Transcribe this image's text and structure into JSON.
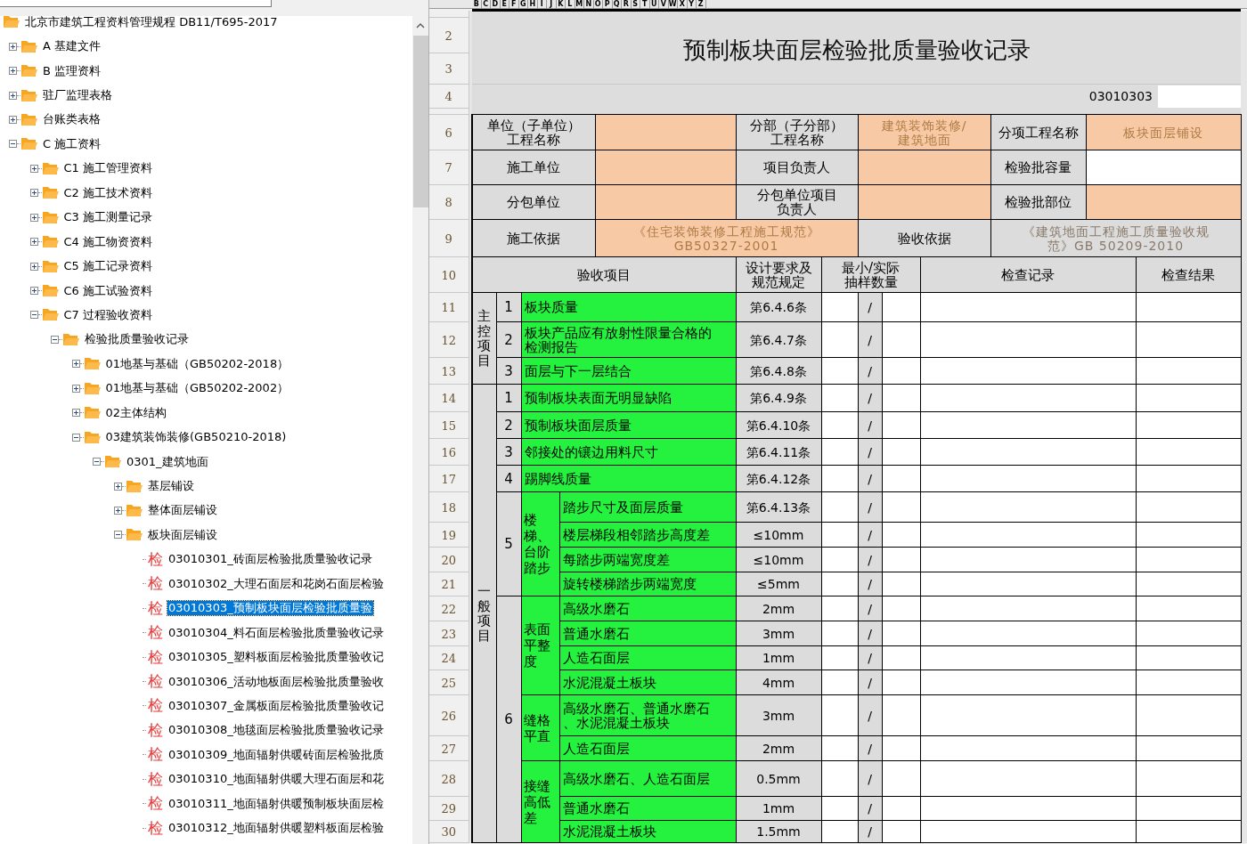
{
  "tree": {
    "label": "北京市建筑工程资料管理规程 DB11/T695-2017",
    "kind": "folder",
    "selected": false,
    "children": [
      {
        "label": "A 基建文件",
        "kind": "folder",
        "expanded": false,
        "selected": false
      },
      {
        "label": "B 监理资料",
        "kind": "folder",
        "expanded": false,
        "selected": false
      },
      {
        "label": "驻厂监理表格",
        "kind": "folder",
        "expanded": false,
        "selected": false
      },
      {
        "label": "台账类表格",
        "kind": "folder",
        "expanded": false,
        "selected": false
      },
      {
        "label": "C 施工资料",
        "kind": "folder",
        "expanded": true,
        "selected": false,
        "children": [
          {
            "label": "C1 施工管理资料",
            "kind": "folder",
            "expanded": false,
            "selected": false
          },
          {
            "label": "C2 施工技术资料",
            "kind": "folder",
            "expanded": false,
            "selected": false
          },
          {
            "label": "C3 施工测量记录",
            "kind": "folder",
            "expanded": false,
            "selected": false
          },
          {
            "label": "C4 施工物资资料",
            "kind": "folder",
            "expanded": false,
            "selected": false
          },
          {
            "label": "C5 施工记录资料",
            "kind": "folder",
            "expanded": false,
            "selected": false
          },
          {
            "label": "C6 施工试验资料",
            "kind": "folder",
            "expanded": false,
            "selected": false
          },
          {
            "label": "C7 过程验收资料",
            "kind": "folder",
            "expanded": true,
            "selected": false,
            "children": [
              {
                "label": "检验批质量验收记录",
                "kind": "folder",
                "expanded": true,
                "selected": false,
                "children": [
                  {
                    "label": "01地基与基础（GB50202-2018）",
                    "kind": "folder",
                    "expanded": false,
                    "selected": false
                  },
                  {
                    "label": "01地基与基础（GB50202-2002）",
                    "kind": "folder",
                    "expanded": false,
                    "selected": false
                  },
                  {
                    "label": "02主体结构",
                    "kind": "folder",
                    "expanded": false,
                    "selected": false
                  },
                  {
                    "label": "03建筑装饰装修(GB50210-2018)",
                    "kind": "folder",
                    "expanded": true,
                    "selected": false,
                    "children": [
                      {
                        "label": "0301_建筑地面",
                        "kind": "folder",
                        "expanded": true,
                        "selected": false,
                        "children": [
                          {
                            "label": "基层铺设",
                            "kind": "folder",
                            "expanded": false,
                            "selected": false
                          },
                          {
                            "label": "整体面层铺设",
                            "kind": "folder",
                            "expanded": false,
                            "selected": false
                          },
                          {
                            "label": "板块面层铺设",
                            "kind": "folder",
                            "expanded": true,
                            "selected": false,
                            "children": [
                              {
                                "label": "03010301_砖面层检验批质量验收记录",
                                "kind": "form",
                                "badge": "检",
                                "selected": false
                              },
                              {
                                "label": "03010302_大理石面层和花岗石面层检验",
                                "kind": "form",
                                "badge": "检",
                                "selected": false
                              },
                              {
                                "label": "03010303_预制板块面层检验批质量验",
                                "kind": "form",
                                "badge": "检",
                                "selected": true
                              },
                              {
                                "label": "03010304_料石面层检验批质量验收记录",
                                "kind": "form",
                                "badge": "检",
                                "selected": false
                              },
                              {
                                "label": "03010305_塑料板面层检验批质量验收记",
                                "kind": "form",
                                "badge": "检",
                                "selected": false
                              },
                              {
                                "label": "03010306_活动地板面层检验批质量验收",
                                "kind": "form",
                                "badge": "检",
                                "selected": false
                              },
                              {
                                "label": "03010307_金属板面层检验批质量验收记",
                                "kind": "form",
                                "badge": "检",
                                "selected": false
                              },
                              {
                                "label": "03010308_地毯面层检验批质量验收记录",
                                "kind": "form",
                                "badge": "检",
                                "selected": false
                              },
                              {
                                "label": "03010309_地面辐射供暖砖面层检验批质",
                                "kind": "form",
                                "badge": "检",
                                "selected": false
                              },
                              {
                                "label": "03010310_地面辐射供暖大理石面层和花",
                                "kind": "form",
                                "badge": "检",
                                "selected": false
                              },
                              {
                                "label": "03010311_地面辐射供暖预制板块面层检",
                                "kind": "form",
                                "badge": "检",
                                "selected": false
                              },
                              {
                                "label": "03010312_地面辐射供暖塑料板面层检验",
                                "kind": "form",
                                "badge": "检",
                                "selected": false
                              }
                            ]
                          }
                        ]
                      }
                    ]
                  }
                ]
              }
            ]
          }
        ]
      }
    ]
  },
  "sheet": {
    "column_letters": [
      "B",
      "C",
      "D",
      "E",
      "F",
      "G",
      "H",
      "I",
      "J",
      "K",
      "L",
      "M",
      "N",
      "O",
      "P",
      "Q",
      "R",
      "S",
      "T",
      "U",
      "V",
      "W",
      "X",
      "Y",
      "Z"
    ],
    "row_numbers": [
      "2",
      "3",
      "4",
      "6",
      "7",
      "8",
      "9",
      "10",
      "11",
      "12",
      "13",
      "14",
      "15",
      "16",
      "17",
      "18",
      "19",
      "20",
      "21",
      "22",
      "23",
      "24",
      "25",
      "26",
      "27",
      "28",
      "29",
      "30"
    ],
    "title": "预制板块面层检验批质量验收记录",
    "form_code": "03010303",
    "info_rows": [
      [
        {
          "kind": "label",
          "text": [
            "单位（子单位）",
            "工程名称"
          ]
        },
        {
          "kind": "input"
        },
        {
          "kind": "label",
          "text": [
            "分部（子分部）",
            "工程名称"
          ]
        },
        {
          "kind": "input",
          "text": [
            "建筑装饰装修/",
            "建筑地面"
          ]
        },
        {
          "kind": "label",
          "text": "分项工程名称"
        },
        {
          "kind": "input",
          "text": "板块面层铺设"
        }
      ],
      [
        {
          "kind": "label",
          "text": "施工单位"
        },
        {
          "kind": "input"
        },
        {
          "kind": "label",
          "text": "项目负责人"
        },
        {
          "kind": "input"
        },
        {
          "kind": "label",
          "text": "检验批容量"
        },
        {
          "kind": "plain"
        }
      ],
      [
        {
          "kind": "label",
          "text": "分包单位"
        },
        {
          "kind": "input"
        },
        {
          "kind": "label",
          "text": [
            "分包单位项目",
            "负责人"
          ]
        },
        {
          "kind": "input"
        },
        {
          "kind": "label",
          "text": "检验批部位"
        },
        {
          "kind": "input"
        }
      ],
      [
        {
          "kind": "label",
          "text": "施工依据"
        },
        {
          "kind": "input",
          "text": [
            "《住宅装饰装修工程施工规范》",
            "GB50327-2001"
          ]
        },
        {
          "kind": "label",
          "text": "验收依据"
        },
        {
          "kind": "note",
          "text": [
            "《建筑地面工程施工质量验收规",
            "范》GB 50209-2010"
          ]
        }
      ]
    ],
    "columns": [
      "验收项目",
      [
        "设计要求及",
        "规范规定"
      ],
      [
        "最小/实际",
        "抽样数量"
      ],
      "检查记录",
      "检查结果"
    ],
    "main_control": {
      "label": "主控项目",
      "items": [
        {
          "kind": "single",
          "no": "1",
          "name": "板块质量",
          "spec": "第6.4.6条",
          "sample": "/"
        },
        {
          "kind": "single",
          "no": "2",
          "name": [
            "板块产品应有放射性限量合格的",
            "检测报告"
          ],
          "spec": "第6.4.7条",
          "sample": "/"
        },
        {
          "kind": "single",
          "no": "3",
          "name": "面层与下一层结合",
          "spec": "第6.4.8条",
          "sample": "/"
        }
      ]
    },
    "general": {
      "label": "一般项目",
      "items": [
        {
          "kind": "single",
          "no": "1",
          "name": "预制板块表面无明显缺陷",
          "spec": "第6.4.9条",
          "sample": "/"
        },
        {
          "kind": "single",
          "no": "2",
          "name": "预制板块面层质量",
          "spec": "第6.4.10条",
          "sample": "/"
        },
        {
          "kind": "single",
          "no": "3",
          "name": "邻接处的镶边用料尺寸",
          "spec": "第6.4.11条",
          "sample": "/"
        },
        {
          "kind": "single",
          "no": "4",
          "name": "踢脚线质量",
          "spec": "第6.4.12条",
          "sample": "/"
        },
        {
          "kind": "group",
          "no": "5",
          "group": "楼梯、台阶踏步",
          "subitems": [
            {
              "name": "踏步尺寸及面层质量",
              "spec": "第6.4.13条",
              "sample": "/"
            },
            {
              "name": "楼层梯段相邻踏步高度差",
              "spec": "≤10mm",
              "sample": "/"
            },
            {
              "name": "每踏步两端宽度差",
              "spec": "≤10mm",
              "sample": "/"
            },
            {
              "name": "旋转楼梯踏步两端宽度",
              "spec": "≤5mm",
              "sample": "/"
            }
          ]
        },
        {
          "kind": "nested",
          "no": "6",
          "subgroups": [
            {
              "label": "表面平整度",
              "subitems": [
                {
                  "name": "高级水磨石",
                  "spec": "2mm",
                  "sample": "/"
                },
                {
                  "name": "普通水磨石",
                  "spec": "3mm",
                  "sample": "/"
                },
                {
                  "name": "人造石面层",
                  "spec": "1mm",
                  "sample": "/"
                },
                {
                  "name": "水泥混凝土板块",
                  "spec": "4mm",
                  "sample": "/"
                }
              ]
            },
            {
              "label": "缝格平直",
              "subitems": [
                {
                  "name": [
                    "高级水磨石、普通水磨石",
                    "、水泥混凝土板块"
                  ],
                  "spec": "3mm",
                  "sample": "/"
                },
                {
                  "name": "人造石面层",
                  "spec": "2mm",
                  "sample": "/"
                }
              ]
            },
            {
              "label": "接缝高低差",
              "subitems": [
                {
                  "name": "高级水磨石、人造石面层",
                  "spec": "0.5mm",
                  "sample": "/"
                },
                {
                  "name": "普通水磨石",
                  "spec": "1mm",
                  "sample": "/"
                },
                {
                  "name": "水泥混凝土板块",
                  "spec": "1.5mm",
                  "sample": "/"
                }
              ]
            }
          ]
        }
      ]
    }
  }
}
